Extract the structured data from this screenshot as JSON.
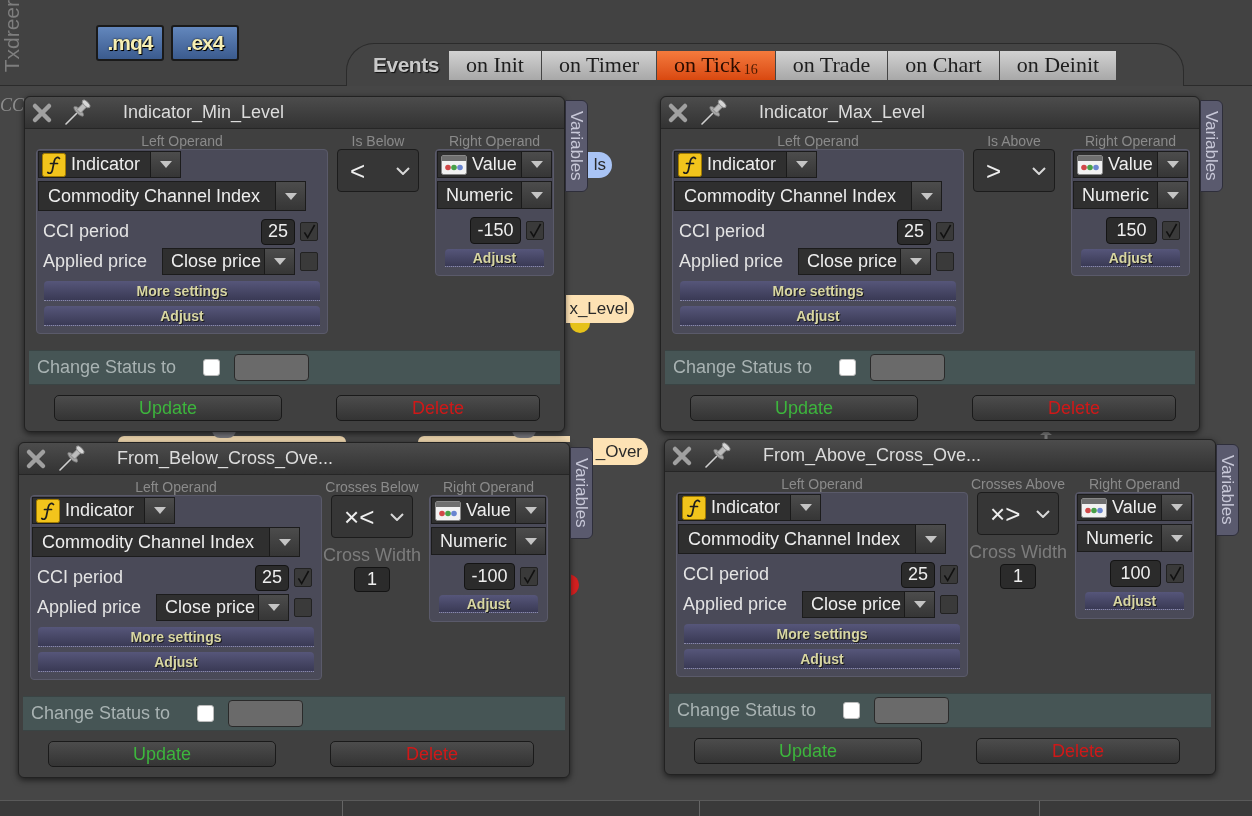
{
  "toolbar": {
    "logo": "Txdreer",
    "file_buttons": [
      ".mq4",
      ".ex4"
    ]
  },
  "events": {
    "label": "Events",
    "tabs": [
      {
        "label": "on Init",
        "selected": false
      },
      {
        "label": "on Timer",
        "selected": false
      },
      {
        "label": "on Tick",
        "count": "16",
        "selected": true
      },
      {
        "label": "on Trade",
        "selected": false
      },
      {
        "label": "on Chart",
        "selected": false
      },
      {
        "label": "on Deinit",
        "selected": false
      }
    ]
  },
  "canvas": {
    "title": "CC",
    "nodes": [
      {
        "kind": "variable",
        "label": "ls"
      },
      {
        "kind": "block",
        "label": "x_Level"
      },
      {
        "kind": "block",
        "label": "_Over"
      }
    ]
  },
  "windows": [
    {
      "title": "Indicator_Min_Level",
      "side_tab": "Variables",
      "left_operand": {
        "label": "Left Operand",
        "source": "Indicator",
        "indicator": "Commodity Channel Index",
        "params": [
          {
            "kind": "number",
            "label": "CCI period",
            "value": "25",
            "checked": true
          },
          {
            "kind": "select",
            "label": "Applied price",
            "value": "Close price",
            "checked": false
          }
        ],
        "buttons": [
          "More settings",
          "Adjust"
        ]
      },
      "operator": {
        "label": "Is Below",
        "symbol": "<"
      },
      "right_operand": {
        "label": "Right Operand",
        "source": "Value",
        "type": "Numeric",
        "value": "-150",
        "checked": true,
        "button": "Adjust"
      },
      "status": {
        "label": "Change Status to",
        "checked": false
      },
      "actions": [
        {
          "kind": "update",
          "label": "Update"
        },
        {
          "kind": "delete",
          "label": "Delete"
        }
      ]
    },
    {
      "title": "Indicator_Max_Level",
      "side_tab": "Variables",
      "left_operand": {
        "label": "Left Operand",
        "source": "Indicator",
        "indicator": "Commodity Channel Index",
        "params": [
          {
            "kind": "number",
            "label": "CCI period",
            "value": "25",
            "checked": true
          },
          {
            "kind": "select",
            "label": "Applied price",
            "value": "Close price",
            "checked": false
          }
        ],
        "buttons": [
          "More settings",
          "Adjust"
        ]
      },
      "operator": {
        "label": "Is Above",
        "symbol": ">"
      },
      "right_operand": {
        "label": "Right Operand",
        "source": "Value",
        "type": "Numeric",
        "value": "150",
        "checked": true,
        "button": "Adjust"
      },
      "status": {
        "label": "Change Status to",
        "checked": false
      },
      "actions": [
        {
          "kind": "update",
          "label": "Update"
        },
        {
          "kind": "delete",
          "label": "Delete"
        }
      ]
    },
    {
      "title": "From_Below_Cross_Ove...",
      "side_tab": "Variables",
      "left_operand": {
        "label": "Left Operand",
        "source": "Indicator",
        "indicator": "Commodity Channel Index",
        "params": [
          {
            "kind": "number",
            "label": "CCI period",
            "value": "25",
            "checked": true
          },
          {
            "kind": "select",
            "label": "Applied price",
            "value": "Close price",
            "checked": false
          }
        ],
        "buttons": [
          "More settings",
          "Adjust"
        ]
      },
      "operator": {
        "label": "Crosses Below",
        "symbol": "×<"
      },
      "cross_width": {
        "label": "Cross Width",
        "value": "1"
      },
      "right_operand": {
        "label": "Right Operand",
        "source": "Value",
        "type": "Numeric",
        "value": "-100",
        "checked": true,
        "button": "Adjust"
      },
      "status": {
        "label": "Change Status to",
        "checked": false
      },
      "actions": [
        {
          "kind": "update",
          "label": "Update"
        },
        {
          "kind": "delete",
          "label": "Delete"
        }
      ]
    },
    {
      "title": "From_Above_Cross_Ove...",
      "side_tab": "Variables",
      "left_operand": {
        "label": "Left Operand",
        "source": "Indicator",
        "indicator": "Commodity Channel Index",
        "params": [
          {
            "kind": "number",
            "label": "CCI period",
            "value": "25",
            "checked": true
          },
          {
            "kind": "select",
            "label": "Applied price",
            "value": "Close price",
            "checked": false
          }
        ],
        "buttons": [
          "More settings",
          "Adjust"
        ]
      },
      "operator": {
        "label": "Crosses Above",
        "symbol": "×>"
      },
      "cross_width": {
        "label": "Cross Width",
        "value": "1"
      },
      "right_operand": {
        "label": "Right Operand",
        "source": "Value",
        "type": "Numeric",
        "value": "100",
        "checked": true,
        "button": "Adjust"
      },
      "status": {
        "label": "Change Status to",
        "checked": false
      },
      "actions": [
        {
          "kind": "update",
          "label": "Update"
        },
        {
          "kind": "delete",
          "label": "Delete"
        }
      ]
    }
  ]
}
